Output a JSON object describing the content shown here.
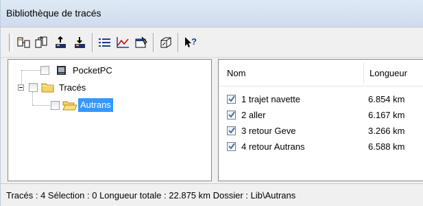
{
  "window": {
    "title": "Bibliothèque de tracés"
  },
  "toolbar": {
    "buttons": [
      {
        "icon": "import-track-icon"
      },
      {
        "icon": "new-folder-icon"
      },
      {
        "icon": "upload-to-device-icon"
      },
      {
        "icon": "download-from-device-icon"
      },
      {
        "icon": "list-view-icon"
      },
      {
        "icon": "profile-chart-icon"
      },
      {
        "icon": "properties-icon"
      },
      {
        "icon": "3d-view-icon"
      },
      {
        "icon": "context-help-icon"
      }
    ]
  },
  "tree": {
    "nodes": [
      {
        "label": "PocketPC",
        "icon": "device-icon"
      },
      {
        "label": "Tracés",
        "icon": "folder-icon"
      },
      {
        "label": "Autrans",
        "icon": "open-folder-icon",
        "selected": true
      }
    ]
  },
  "list": {
    "columns": [
      "Nom",
      "Longueur"
    ],
    "rows": [
      {
        "name": "1 trajet navette",
        "length": "6.854 km",
        "checked": true
      },
      {
        "name": "2 aller",
        "length": "6.167 km",
        "checked": true
      },
      {
        "name": "3 retour Geve",
        "length": "3.266 km",
        "checked": true
      },
      {
        "name": "4 retour Autrans",
        "length": "6.588 km",
        "checked": true
      }
    ]
  },
  "status": {
    "text": "Tracés : 4 Sélection : 0 Longueur totale : 22.875 km Dossier : Lib\\Autrans"
  },
  "colors": {
    "selection": "#3399ff",
    "titlebar": "#dfe9f5",
    "check": "#3b6fb3"
  }
}
